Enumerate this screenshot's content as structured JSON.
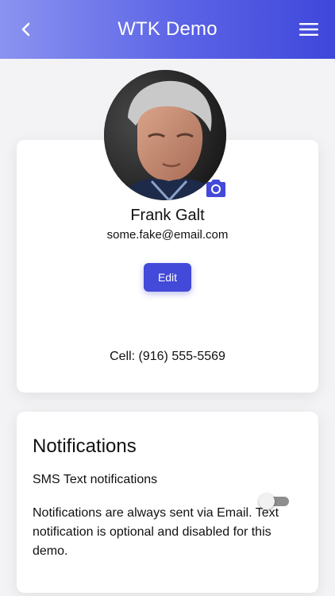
{
  "appbar": {
    "title": "WTK Demo",
    "back_icon": "chevron-left-icon",
    "menu_icon": "hamburger-menu-icon",
    "gradient_start": "#8b93f0",
    "gradient_end": "#3f47db"
  },
  "profile": {
    "name": "Frank Galt",
    "email": "some.fake@email.com",
    "edit_label": "Edit",
    "cell": "Cell: (916) 555-5569",
    "camera_icon": "camera-icon",
    "accent_color": "#4349d8"
  },
  "notifications": {
    "title": "Notifications",
    "sms_label": "SMS Text notifications",
    "description": "Notifications are always sent via Email. Text notification is optional and disabled for this demo.",
    "sms_enabled": false
  }
}
